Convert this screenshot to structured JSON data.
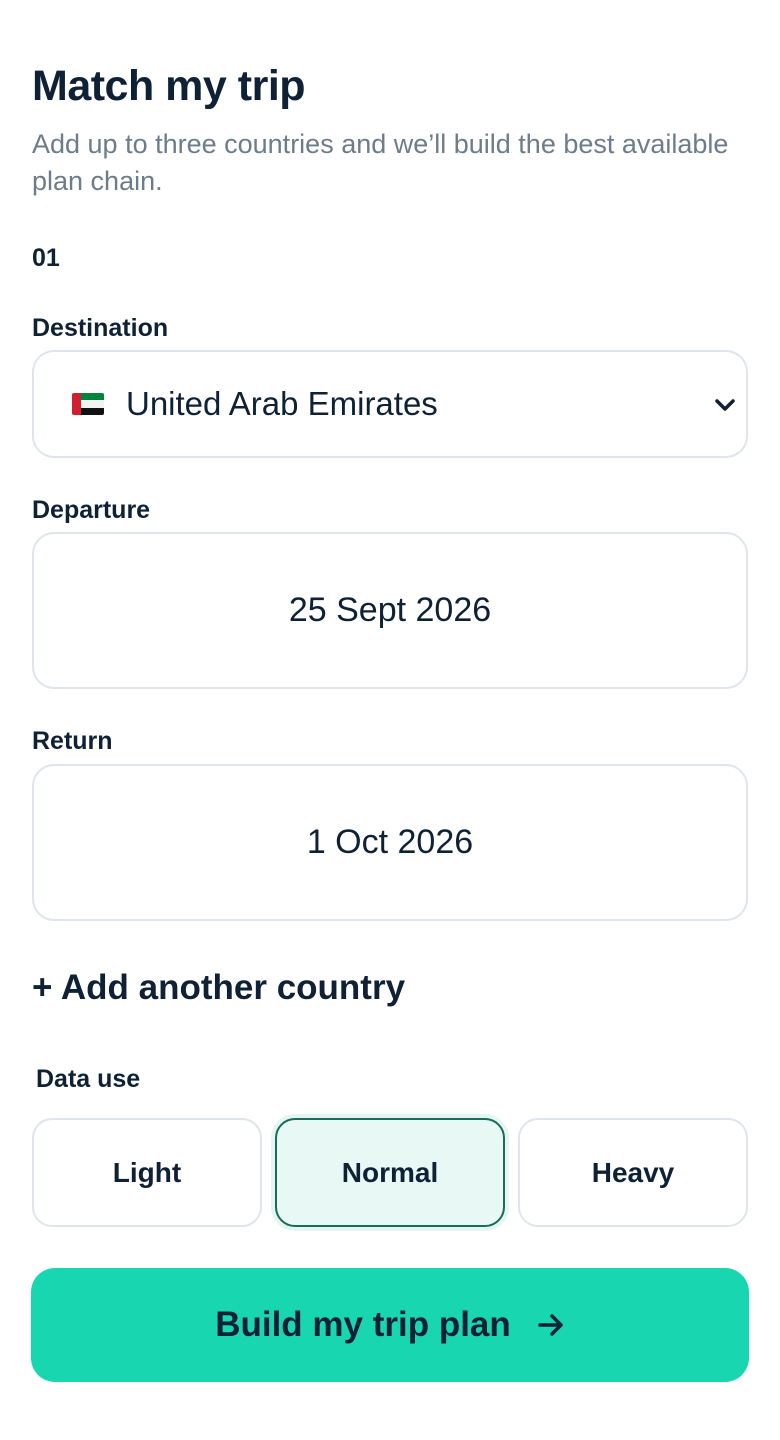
{
  "header": {
    "title": "Match my trip",
    "subtitle": "Add up to three countries and we’ll build the best available plan chain."
  },
  "trip": {
    "step": "01",
    "destination": {
      "label": "Destination",
      "value": "United Arab Emirates",
      "flag_icon": "uae-flag-icon"
    },
    "departure": {
      "label": "Departure",
      "value": "25 Sept 2026"
    },
    "return": {
      "label": "Return",
      "value": "1 Oct 2026"
    }
  },
  "add_country_label": "+ Add another country",
  "data_use": {
    "label": "Data use",
    "options": [
      "Light",
      "Normal",
      "Heavy"
    ],
    "selected": "Normal"
  },
  "cta": {
    "label": "Build my trip plan",
    "icon": "arrow-right-icon"
  },
  "colors": {
    "accent": "#18d6b0",
    "text": "#0f2135",
    "muted": "#6d7c8b",
    "border": "#dfe5ea",
    "selected_border": "#1a6b5a",
    "selected_bg": "#e8f8f4"
  }
}
